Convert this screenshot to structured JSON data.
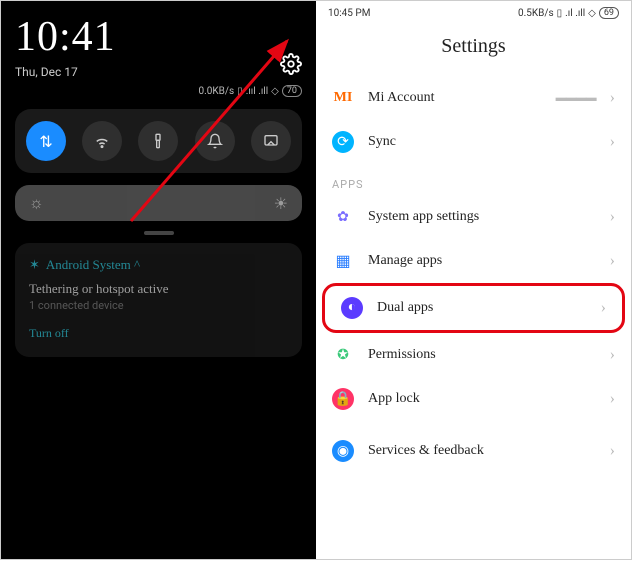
{
  "left": {
    "clock": "10:41",
    "date": "Thu, Dec 17",
    "data_rate": "0.0KB/s",
    "signal_text": ".ııl .ıll",
    "battery": "70",
    "quick_settings": {
      "data": "data-toggle",
      "wifi": "wifi-toggle",
      "flashlight": "flashlight-toggle",
      "bell": "silent-toggle",
      "cast": "cast-toggle"
    },
    "notification": {
      "app": "Android System ^",
      "title": "Tethering or hotspot active",
      "subtitle": "1 connected device",
      "action": "Turn off"
    }
  },
  "right": {
    "status_time": "10:45 PM",
    "status_data_rate": "0.5KB/s",
    "status_battery": "69",
    "title": "Settings",
    "rows": {
      "mi_account": {
        "label": "Mi Account",
        "detail": "▬▬▬▬"
      },
      "sync": {
        "label": "Sync"
      },
      "section_apps": "APPS",
      "system_app": {
        "label": "System app settings"
      },
      "manage_apps": {
        "label": "Manage apps"
      },
      "dual_apps": {
        "label": "Dual apps"
      },
      "permissions": {
        "label": "Permissions"
      },
      "app_lock": {
        "label": "App lock"
      },
      "services": {
        "label": "Services & feedback"
      }
    }
  },
  "colors": {
    "accent_blue": "#1a8cff",
    "highlight_red": "#e30613"
  }
}
